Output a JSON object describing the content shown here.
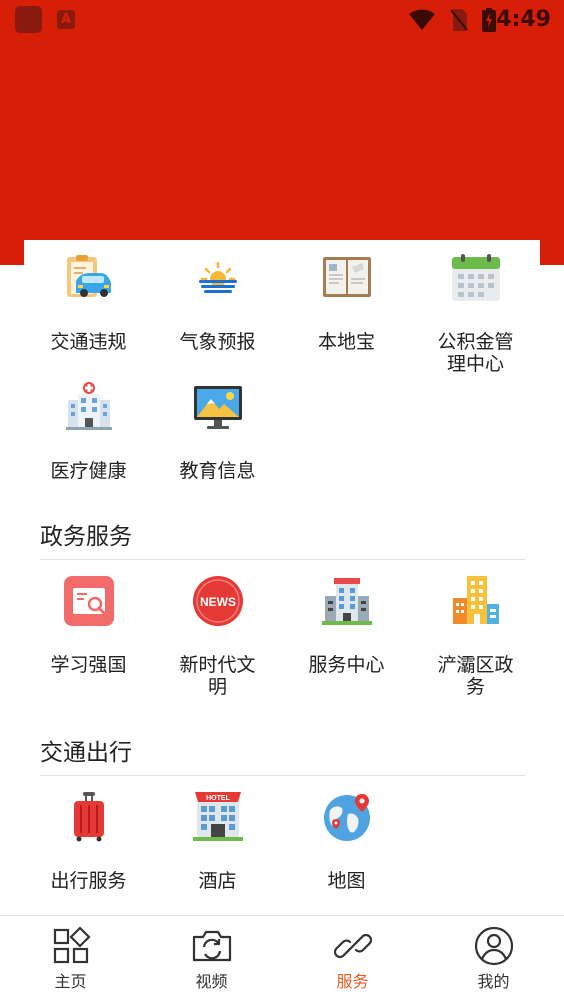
{
  "status_bar": {
    "time": "4:49",
    "app_badge": "A",
    "color": "#d81e06"
  },
  "quick_services": {
    "items": [
      {
        "label": "交通违规",
        "icon": "traffic-violation-icon"
      },
      {
        "label": "气象预报",
        "icon": "weather-forecast-icon"
      },
      {
        "label": "本地宝",
        "icon": "local-guide-book-icon"
      },
      {
        "label": "公积金管理中心",
        "icon": "calendar-icon"
      },
      {
        "label": "医疗健康",
        "icon": "hospital-icon"
      },
      {
        "label": "教育信息",
        "icon": "monitor-landscape-icon"
      }
    ]
  },
  "government": {
    "title": "政务服务",
    "items": [
      {
        "label": "学习强国",
        "icon": "study-search-icon"
      },
      {
        "label": "新时代文明",
        "icon": "news-icon",
        "badge": "NEWS"
      },
      {
        "label": "服务中心",
        "icon": "office-building-icon"
      },
      {
        "label": "浐灞区政务",
        "icon": "city-buildings-icon"
      }
    ]
  },
  "transport": {
    "title": "交通出行",
    "items": [
      {
        "label": "出行服务",
        "icon": "suitcase-icon"
      },
      {
        "label": "酒店",
        "icon": "hotel-icon",
        "badge": "HOTEL"
      },
      {
        "label": "地图",
        "icon": "globe-map-icon"
      }
    ]
  },
  "bottom_nav": {
    "active_color": "#e85b22",
    "items": [
      {
        "label": "主页",
        "icon": "home-grid-icon"
      },
      {
        "label": "视频",
        "icon": "camera-icon"
      },
      {
        "label": "服务",
        "icon": "link-icon",
        "active": true
      },
      {
        "label": "我的",
        "icon": "user-icon"
      }
    ]
  }
}
